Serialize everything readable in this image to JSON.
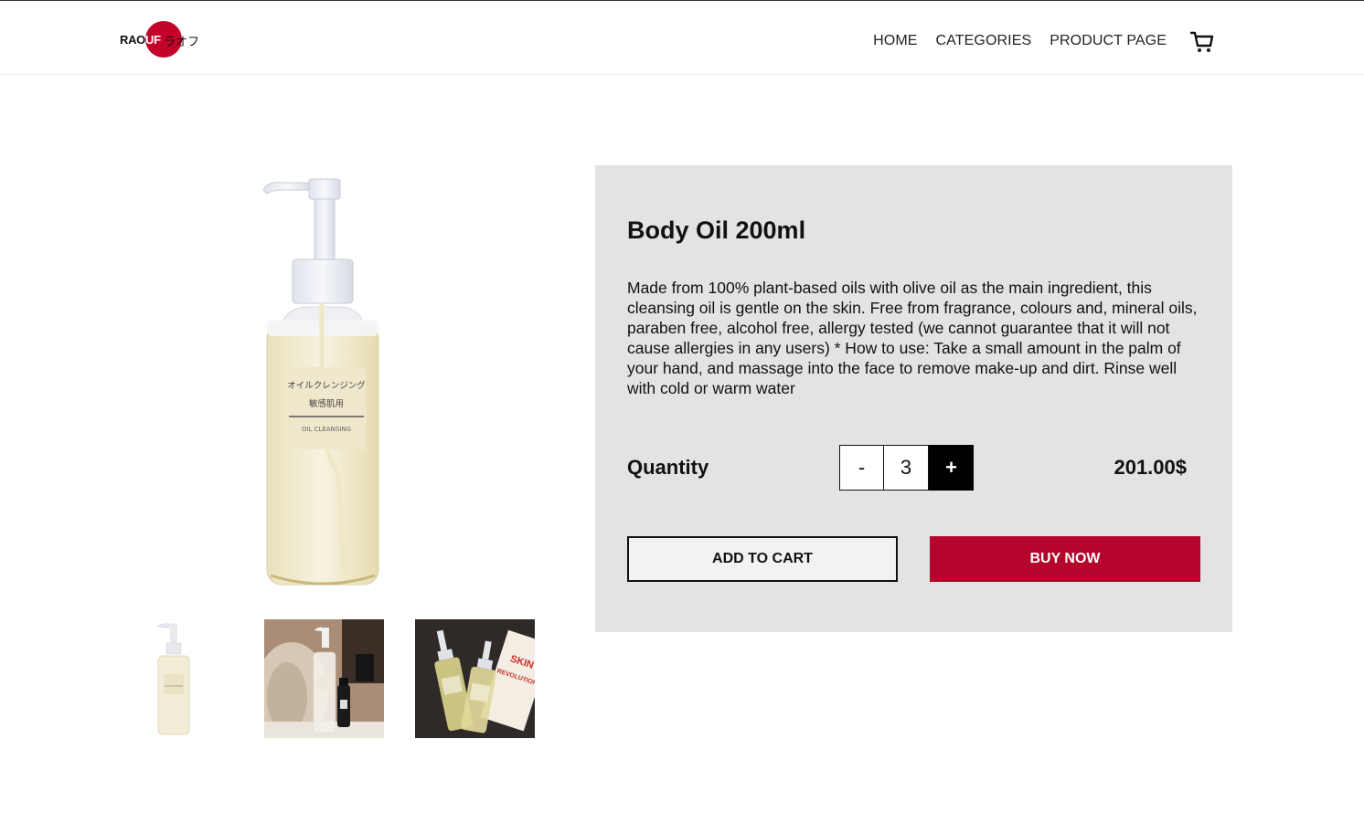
{
  "brand": {
    "logo_text_left": "RAO",
    "logo_text_right": "UF",
    "logo_text_jp": "ラオフ",
    "accent_color": "#c3022a"
  },
  "nav": {
    "items": [
      {
        "label": "HOME"
      },
      {
        "label": "CATEGORIES"
      },
      {
        "label": "PRODUCT PAGE"
      }
    ],
    "cart_icon": "cart-icon"
  },
  "product": {
    "bottle_label_jp_1": "オイルクレンジング",
    "bottle_label_jp_2": "敏感肌用",
    "bottle_label_en": "OIL CLEANSING",
    "title": "Body Oil 200ml",
    "description": "Made from 100% plant-based oils with olive oil as the main ingredient, this cleansing oil is gentle on the skin. Free from fragrance, colours and, mineral oils, paraben free, alcohol free, allergy tested (we cannot guarantee that it will not cause allergies in any users) * How to use: Take a small amount in the palm of your hand, and massage into the face to remove make-up and dirt. Rinse well with cold or warm water",
    "quantity_label": "Quantity",
    "quantity": "3",
    "minus_label": "-",
    "plus_label": "+",
    "price": "201.00$",
    "add_to_cart_label": "ADD TO CART",
    "buy_now_label": "BUY NOW",
    "buy_color": "#b5052c"
  },
  "thumbnails": {
    "thumb3_text_1": "SKIN",
    "thumb3_text_2": "REVOLUTION"
  }
}
